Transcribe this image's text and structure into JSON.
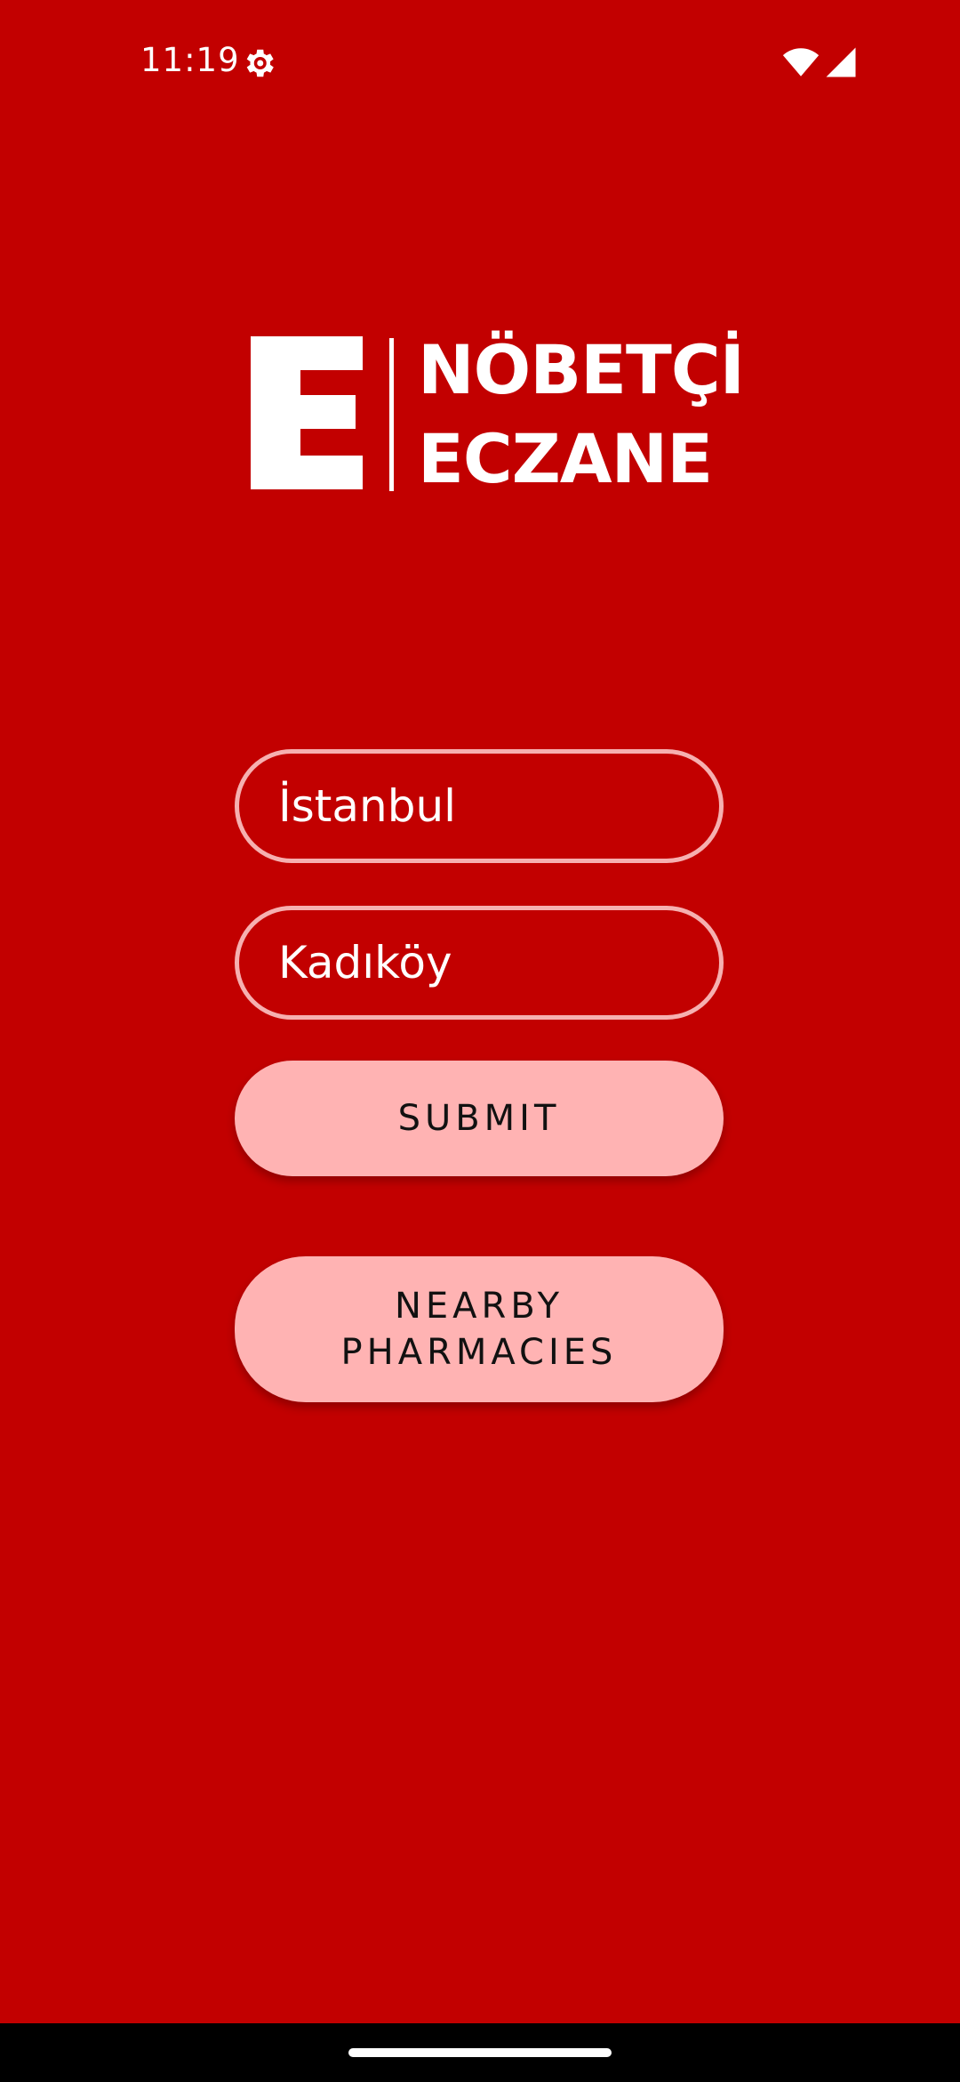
{
  "status_bar": {
    "time": "11:19",
    "icons": [
      "gear-icon",
      "wifi-icon",
      "signal-icon"
    ]
  },
  "logo": {
    "mark": "E",
    "line1": "NÖBETÇİ",
    "line2": "ECZANE"
  },
  "form": {
    "city_value": "İstanbul",
    "district_value": "Kadıköy"
  },
  "buttons": {
    "submit_label": "SUBMIT",
    "nearby_label_line1": "NEARBY",
    "nearby_label_line2": "PHARMACIES"
  },
  "colors": {
    "background": "#c20000",
    "button": "#ffb3b3",
    "field_border": "#f6b0b0"
  }
}
